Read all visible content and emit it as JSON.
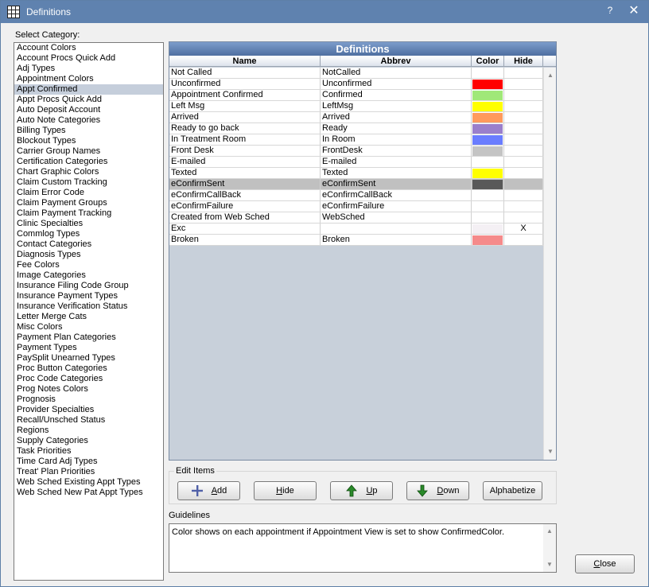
{
  "window": {
    "title": "Definitions",
    "help_label": "?",
    "close_label": "✕"
  },
  "select_category_label": "Select Category:",
  "categories": [
    "Account Colors",
    "Account Procs Quick Add",
    "Adj Types",
    "Appointment Colors",
    "Appt Confirmed",
    "Appt Procs Quick Add",
    "Auto Deposit Account",
    "Auto Note Categories",
    "Billing Types",
    "Blockout Types",
    "Carrier Group Names",
    "Certification Categories",
    "Chart Graphic Colors",
    "Claim Custom Tracking",
    "Claim Error Code",
    "Claim Payment Groups",
    "Claim Payment Tracking",
    "Clinic Specialties",
    "Commlog Types",
    "Contact Categories",
    "Diagnosis Types",
    "Fee Colors",
    "Image Categories",
    "Insurance Filing Code Group",
    "Insurance Payment Types",
    "Insurance Verification Status",
    "Letter Merge Cats",
    "Misc Colors",
    "Payment Plan Categories",
    "Payment Types",
    "PaySplit Unearned Types",
    "Proc Button Categories",
    "Proc Code Categories",
    "Prog Notes Colors",
    "Prognosis",
    "Provider Specialties",
    "Recall/Unsched Status",
    "Regions",
    "Supply Categories",
    "Task Priorities",
    "Time Card Adj Types",
    "Treat' Plan Priorities",
    "Web Sched Existing Appt Types",
    "Web Sched New Pat Appt Types"
  ],
  "selected_category_index": 4,
  "grid": {
    "title": "Definitions",
    "columns": {
      "name": "Name",
      "abbrev": "Abbrev",
      "color": "Color",
      "hide": "Hide"
    },
    "rows": [
      {
        "name": "Not Called",
        "abbrev": "NotCalled",
        "color": "#ffffff",
        "hide": ""
      },
      {
        "name": "Unconfirmed",
        "abbrev": "Unconfirmed",
        "color": "#ff0000",
        "hide": ""
      },
      {
        "name": "Appointment Confirmed",
        "abbrev": "Confirmed",
        "color": "#a0e878",
        "hide": ""
      },
      {
        "name": "Left Msg",
        "abbrev": "LeftMsg",
        "color": "#ffff00",
        "hide": ""
      },
      {
        "name": "Arrived",
        "abbrev": "Arrived",
        "color": "#ff9a5c",
        "hide": ""
      },
      {
        "name": "Ready to go back",
        "abbrev": "Ready",
        "color": "#9a7fcc",
        "hide": ""
      },
      {
        "name": "In Treatment Room",
        "abbrev": "In Room",
        "color": "#6a7dff",
        "hide": ""
      },
      {
        "name": "Front Desk",
        "abbrev": "FrontDesk",
        "color": "#c4c4c4",
        "hide": ""
      },
      {
        "name": "E-mailed",
        "abbrev": "E-mailed",
        "color": "#ffffff",
        "hide": ""
      },
      {
        "name": "Texted",
        "abbrev": "Texted",
        "color": "#ffff00",
        "hide": ""
      },
      {
        "name": "eConfirmSent",
        "abbrev": "eConfirmSent",
        "color": "#595959",
        "hide": ""
      },
      {
        "name": "eConfirmCallBack",
        "abbrev": "eConfirmCallBack",
        "color": "#ffffff",
        "hide": ""
      },
      {
        "name": "eConfirmFailure",
        "abbrev": "eConfirmFailure",
        "color": "#ffffff",
        "hide": ""
      },
      {
        "name": "Created from Web Sched",
        "abbrev": "WebSched",
        "color": "#ffffff",
        "hide": ""
      },
      {
        "name": "Exc",
        "abbrev": "",
        "color": "#f4f0f4",
        "hide": "X"
      },
      {
        "name": "Broken",
        "abbrev": "Broken",
        "color": "#f58a8a",
        "hide": ""
      }
    ],
    "selected_row_index": 10
  },
  "edit_items": {
    "label": "Edit Items",
    "add": {
      "accel": "A",
      "rest": "dd"
    },
    "hide": {
      "accel": "H",
      "rest": "ide"
    },
    "up": {
      "accel": "U",
      "rest": "p"
    },
    "down": {
      "accel": "D",
      "rest": "own"
    },
    "alphabetize": "Alphabetize"
  },
  "guidelines": {
    "label": "Guidelines",
    "text": "Color shows on each appointment if Appointment View is set to show ConfirmedColor."
  },
  "close_button": {
    "accel": "C",
    "rest": "lose"
  },
  "colors": {
    "titlebar": "#5f82af",
    "selection": "#c5cedb",
    "selected_row": "#c0c0c0",
    "plus_icon": "#5060a8",
    "arrow_icon": "#2a8a2a"
  }
}
